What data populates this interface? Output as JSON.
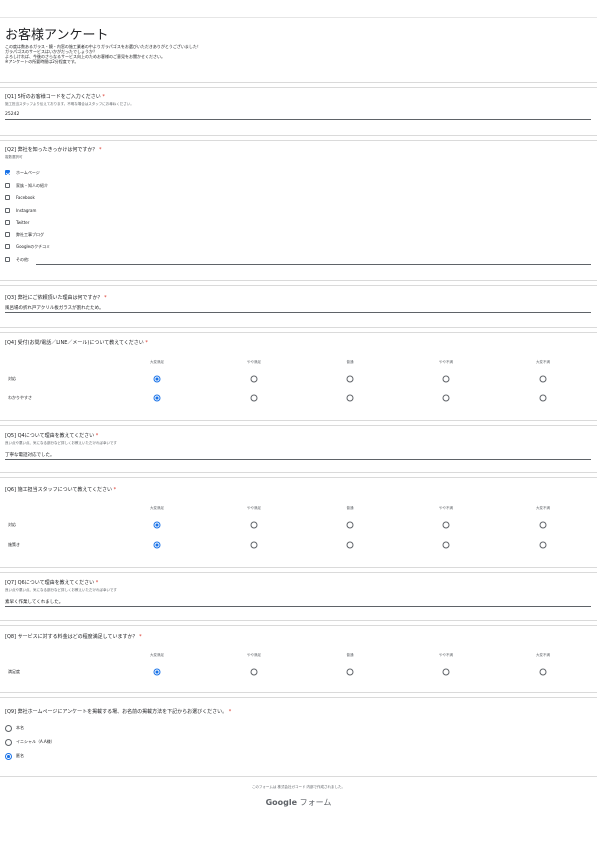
{
  "form": {
    "title": "お客様アンケート",
    "description": [
      "この度は数あるガラス・鏡・内窓の施工業者の中よりガラパゴスをお選びいただきありがとうございました！",
      "ガラパゴスのサービスはいかがだったでしょうか？",
      "よろしければ、今後のさらなるサービス向上のためお客様のご意見をお聞かせください。",
      "※アンケートの所要時間は2分程度です。"
    ]
  },
  "q1": {
    "title": "[Q1] 5桁のお客様コードをご入力ください",
    "required": "*",
    "help": "施工担当スタッフより伝えております。不明な場合はスタッフにお尋ねください。",
    "answer": "25242"
  },
  "q2": {
    "title": "[Q2] 弊社を知ったきっかけは何ですか？",
    "required": "*",
    "help": "複数選択可",
    "options": [
      {
        "label": "ホームページ",
        "checked": true
      },
      {
        "label": "家族・知人の紹介",
        "checked": false
      },
      {
        "label": "Facebook",
        "checked": false
      },
      {
        "label": "Instagram",
        "checked": false
      },
      {
        "label": "Twitter",
        "checked": false
      },
      {
        "label": "弊社工事ブログ",
        "checked": false
      },
      {
        "label": "Googleのクチコミ",
        "checked": false
      },
      {
        "label": "その他:",
        "checked": false
      }
    ]
  },
  "q3": {
    "title": "[Q3] 弊社にご依頼頂いた理由は何ですか？",
    "required": "*",
    "answer": "風呂場の折れ戸アクリル板ガラスが割れたため。"
  },
  "q4": {
    "title": "[Q4] 受付(お問/電話／LINE／メール)について教えてください",
    "required": "*",
    "columns": [
      "大変満足",
      "やや満足",
      "普通",
      "やや不満",
      "大変不満"
    ],
    "rows": [
      {
        "label": "対応",
        "selected": 0
      },
      {
        "label": "わかりやすさ",
        "selected": 0
      }
    ]
  },
  "q5": {
    "title": "[Q5] Q4について理由を教えてください",
    "required": "*",
    "help": "良い点や悪い点、気になる部分など詳しくお教えいただければ幸いです",
    "answer": "丁寧な電話対応でした。"
  },
  "q6": {
    "title": "[Q6] 施工担当スタッフについて教えてください",
    "required": "*",
    "columns": [
      "大変満足",
      "やや満足",
      "普通",
      "やや不満",
      "大変不満"
    ],
    "rows": [
      {
        "label": "対応",
        "selected": 0
      },
      {
        "label": "施策き",
        "selected": 0
      }
    ]
  },
  "q7": {
    "title": "[Q7] Q6について理由を教えてください",
    "required": "*",
    "help": "良い点や悪い点、気になる部分など詳しくお教えいただければ幸いです",
    "answer": "素早く作業してくれました。"
  },
  "q8": {
    "title": "[Q8] サービスに対する料金はどの程度満足していますか？",
    "required": "*",
    "columns": [
      "大変満足",
      "やや満足",
      "普通",
      "やや不満",
      "大変不満"
    ],
    "rows": [
      {
        "label": "満足度",
        "selected": 0
      }
    ]
  },
  "q9": {
    "title": "[Q9] 弊社ホームページにアンケートを掲載する場、お名前の掲載方法を下記からお選びください。",
    "required": "*",
    "options": [
      {
        "label": "本名",
        "selected": false
      },
      {
        "label": "イニシャル（A.A様）",
        "selected": false
      },
      {
        "label": "匿名",
        "selected": true
      }
    ]
  },
  "footer": {
    "note": "このフォームは 株式会社ガコード 内部で作成されました。",
    "logo_google": "Google",
    "logo_forms": "フォーム"
  },
  "colors": {
    "accent": "#1a73e8",
    "required": "#d93025",
    "divider": "#dadada"
  }
}
